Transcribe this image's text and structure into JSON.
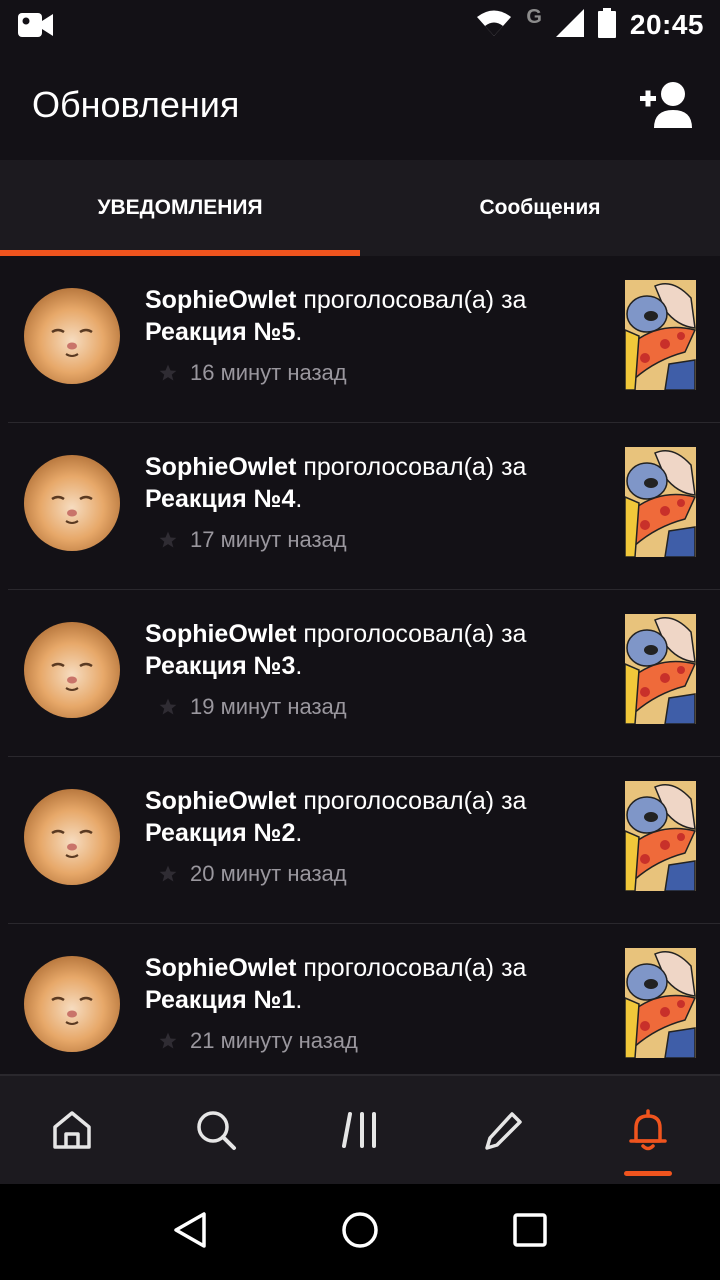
{
  "status_bar": {
    "time": "20:45",
    "network_label": "G",
    "icons": [
      "video-camera-icon",
      "wifi-icon",
      "signal-icon",
      "battery-icon"
    ]
  },
  "app_bar": {
    "title": "Обновления",
    "add_user_icon": "add-user-icon"
  },
  "tabs": [
    {
      "label": "УВЕДОМЛЕНИЯ",
      "active": true
    },
    {
      "label": "Сообщения",
      "active": false
    }
  ],
  "notifications": [
    {
      "user": "SophieOwlet",
      "action": "проголосовал(а) за",
      "target": "Реакция №5",
      "time": "16 минут назад"
    },
    {
      "user": "SophieOwlet",
      "action": "проголосовал(а) за",
      "target": "Реакция №4",
      "time": "17 минут назад"
    },
    {
      "user": "SophieOwlet",
      "action": "проголосовал(а) за",
      "target": "Реакция №3",
      "time": "19 минут назад"
    },
    {
      "user": "SophieOwlet",
      "action": "проголосовал(а) за",
      "target": "Реакция №2",
      "time": "20 минут назад"
    },
    {
      "user": "SophieOwlet",
      "action": "проголосовал(а) за",
      "target": "Реакция №1",
      "time": "21 минуту назад"
    }
  ],
  "bottom_nav": [
    {
      "icon": "home-icon",
      "active": false
    },
    {
      "icon": "search-icon",
      "active": false
    },
    {
      "icon": "library-icon",
      "active": false
    },
    {
      "icon": "pencil-icon",
      "active": false
    },
    {
      "icon": "bell-icon",
      "active": true
    }
  ],
  "system_nav": [
    "back-icon",
    "home-circle-icon",
    "recents-icon"
  ],
  "colors": {
    "accent": "#f0541e",
    "background": "#131116",
    "surface": "#1c1a1f",
    "muted_text": "#9a979e"
  }
}
